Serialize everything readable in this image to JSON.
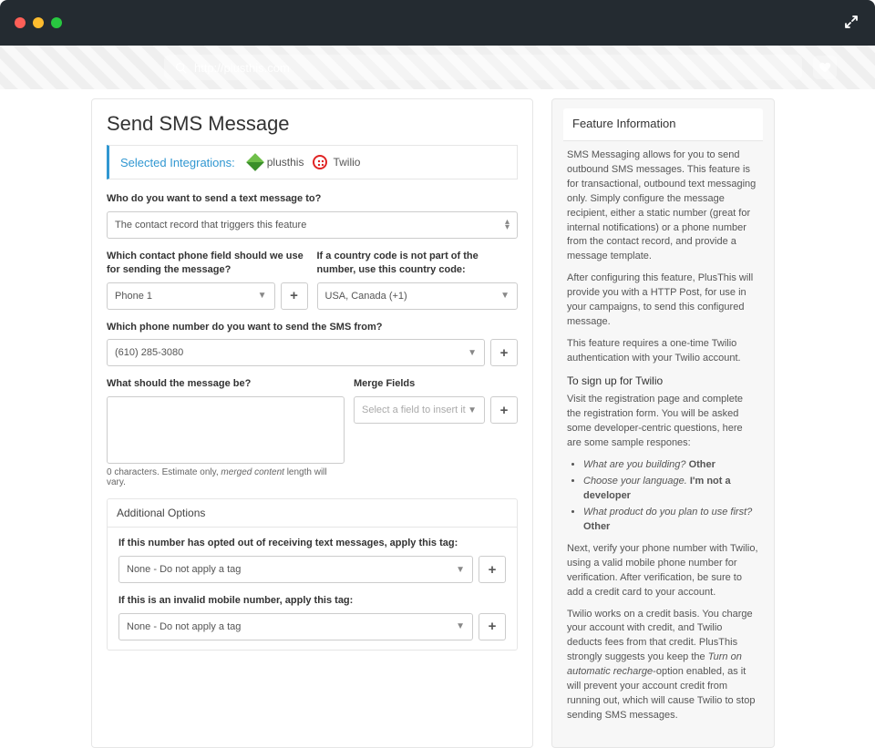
{
  "browser": {
    "url": "http://plusthis.com"
  },
  "page": {
    "title": "Send SMS Message",
    "selected_integrations_label": "Selected Integrations:",
    "integrations": {
      "plusthis": "plusthis",
      "twilio": "Twilio"
    },
    "recipient": {
      "label": "Who do you want to send a text message to?",
      "value": "The contact record that triggers this feature"
    },
    "phone_field": {
      "label": "Which contact phone field should we use for sending the message?",
      "value": "Phone 1"
    },
    "country_code": {
      "label": "If a country code is not part of the number, use this country code:",
      "value": "USA, Canada (+1)"
    },
    "from_number": {
      "label": "Which phone number do you want to send the SMS from?",
      "value": "(610) 285-3080"
    },
    "message": {
      "label": "What should the message be?",
      "value": "",
      "hint_prefix": "0 characters. Estimate only, ",
      "hint_italic": "merged content",
      "hint_suffix": " length will vary."
    },
    "merge": {
      "label": "Merge Fields",
      "placeholder": "Select a field to insert it"
    },
    "options_title": "Additional Options",
    "opt_out": {
      "label": "If this number has opted out of receiving text messages, apply this tag:",
      "value": "None - Do not apply a tag"
    },
    "invalid": {
      "label": "If this is an invalid mobile number, apply this tag:",
      "value": "None - Do not apply a tag"
    }
  },
  "sidebar": {
    "title": "Feature Information",
    "p1": "SMS Messaging allows for you to send outbound SMS messages. This feature is for transactional, outbound text messaging only. Simply configure the message recipient, either a static number (great for internal notifications) or a phone number from the contact record, and provide a message template.",
    "p2": "After configuring this feature, PlusThis will provide you with a HTTP Post, for use in your campaigns, to send this configured message.",
    "p3": "This feature requires a one-time Twilio authentication with your Twilio account.",
    "signup_heading": "To sign up for Twilio",
    "p4": "Visit the registration page and complete the registration form. You will be asked some developer-centric questions, here are some sample respones:",
    "q1_i": "What are you building?",
    "q1_b": "Other",
    "q2_i": "Choose your language.",
    "q2_b": "I'm not a developer",
    "q3_i": "What product do you plan to use first?",
    "q3_b": "Other",
    "p5": "Next, verify your phone number with Twilio, using a valid mobile phone number for verification. After verification, be sure to add a credit card to your account.",
    "p6_a": "Twilio works on a credit basis. You charge your account with credit, and Twilio deducts fees from that credit. PlusThis strongly suggests you keep the ",
    "p6_i": "Turn on automatic recharge",
    "p6_b": "-option enabled, as it will prevent your account credit from running out, which will cause Twilio to stop sending SMS messages."
  }
}
